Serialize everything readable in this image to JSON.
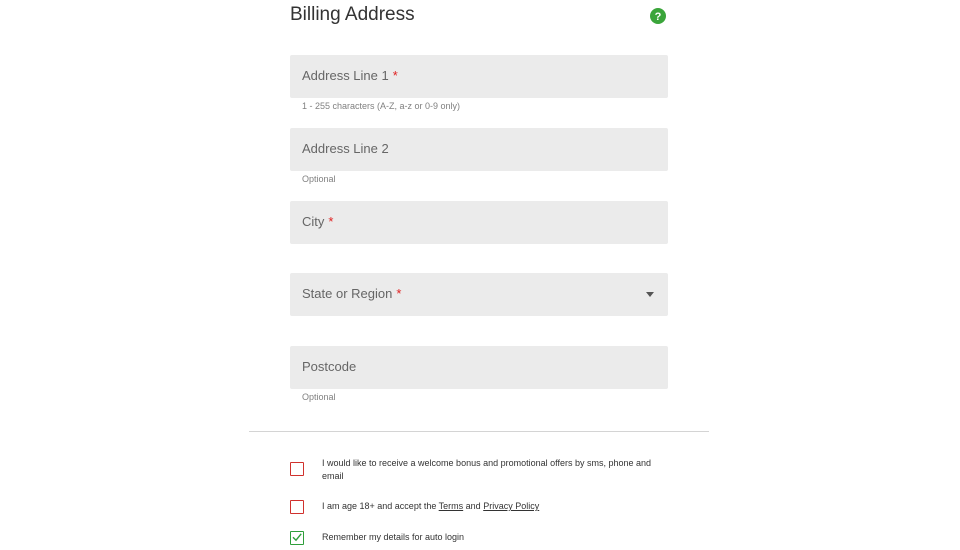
{
  "billing": {
    "title": "Billing Address",
    "help_icon": "question-circle-icon",
    "fields": {
      "address1": {
        "label": "Address Line 1",
        "required_mark": "*",
        "hint": "1 - 255 characters (A-Z, a-z or 0-9 only)"
      },
      "address2": {
        "label": "Address Line 2",
        "hint": "Optional"
      },
      "city": {
        "label": "City",
        "required_mark": "*"
      },
      "state": {
        "label": "State or Region",
        "required_mark": "*",
        "dropdown_icon": "caret-down-icon"
      },
      "postcode": {
        "label": "Postcode",
        "hint": "Optional"
      }
    }
  },
  "consents": {
    "promo": {
      "text": "I would like to receive a welcome bonus and promotional offers by sms, phone and email",
      "checked": false
    },
    "age": {
      "prefix": "I am age 18+ and accept the ",
      "terms_link": "Terms",
      "and": " and ",
      "privacy_link": "Privacy Policy",
      "checked": false
    },
    "remember": {
      "text": "Remember my details for auto login",
      "checked": true
    }
  },
  "colors": {
    "accent_green": "#2e9e3a",
    "required_red": "#e02020",
    "checkbox_red": "#d0312d",
    "field_bg": "#ebebeb"
  }
}
